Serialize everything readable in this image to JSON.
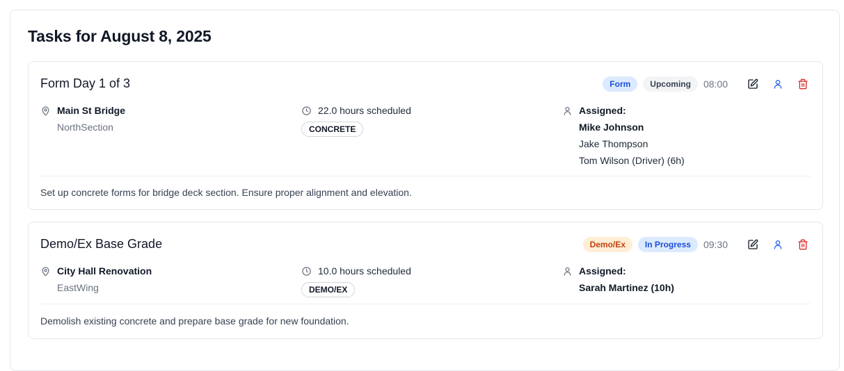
{
  "page": {
    "title": "Tasks for August 8, 2025"
  },
  "tasks": [
    {
      "title": "Form Day 1 of 3",
      "type_badge": "Form",
      "status_badge": "Upcoming",
      "time": "08:00",
      "location": "Main St Bridge",
      "section": "NorthSection",
      "hours": "22.0 hours scheduled",
      "tag": "CONCRETE",
      "assigned_label": "Assigned:",
      "assignees": [
        "Mike Johnson",
        "Jake Thompson",
        "Tom Wilson (Driver) (6h)"
      ],
      "description": "Set up concrete forms for bridge deck section. Ensure proper alignment and elevation.",
      "colors": {
        "type_bg": "#dbeafe",
        "type_fg": "#1d4ed8",
        "status_bg": "#f3f4f6",
        "status_fg": "#374151"
      }
    },
    {
      "title": "Demo/Ex Base Grade",
      "type_badge": "Demo/Ex",
      "status_badge": "In Progress",
      "time": "09:30",
      "location": "City Hall Renovation",
      "section": "EastWing",
      "hours": "10.0 hours scheduled",
      "tag": "DEMO/EX",
      "assigned_label": "Assigned:",
      "assignees": [
        "Sarah Martinez (10h)"
      ],
      "description": "Demolish existing concrete and prepare base grade for new foundation.",
      "colors": {
        "type_bg": "#ffedd5",
        "type_fg": "#c2410c",
        "status_bg": "#dbeafe",
        "status_fg": "#1d4ed8"
      }
    }
  ],
  "icons": {
    "location": "map-pin-icon",
    "hours": "clock-icon",
    "assigned": "user-icon",
    "edit": "edit-icon",
    "assign": "user-icon",
    "delete": "trash-icon"
  },
  "colors": {
    "edit": "#111827",
    "assign": "#2563eb",
    "delete": "#dc2626"
  }
}
